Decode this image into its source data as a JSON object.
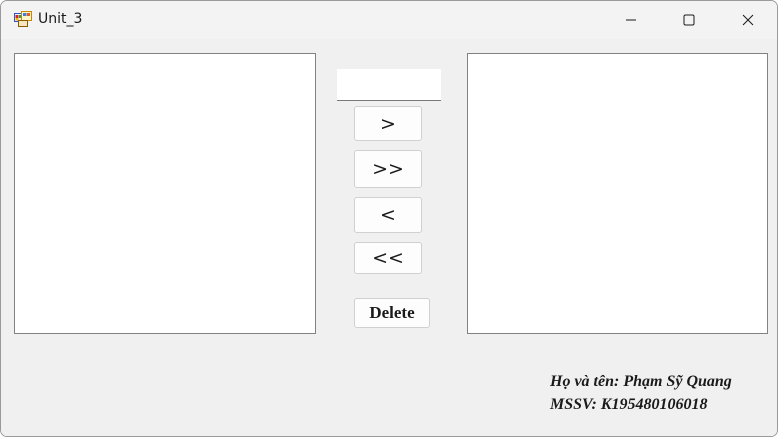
{
  "window": {
    "title": "Unit_3",
    "icon": "winforms-app-icon",
    "controls": {
      "minimize_icon": "minimize-icon",
      "maximize_icon": "maximize-icon",
      "close_icon": "close-icon"
    }
  },
  "textbox": {
    "value": ""
  },
  "buttons": {
    "move_one_right": ">",
    "move_all_right": ">>",
    "move_one_left": "<",
    "move_all_left": "<<",
    "delete": "Delete"
  },
  "author": {
    "name_line": "Họ và tên: Phạm Sỹ Quang",
    "id_line": "MSSV: K195480106018"
  },
  "lists": {
    "left_items": [],
    "right_items": []
  },
  "colors": {
    "background": "#f0f0f0",
    "titlebar": "#f3f3f3",
    "list_border": "#828282"
  }
}
